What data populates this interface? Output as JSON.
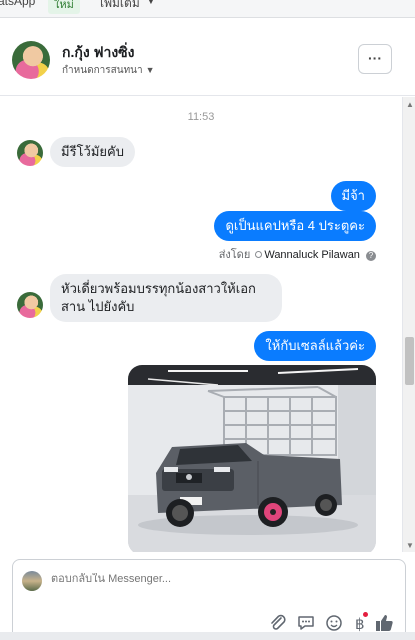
{
  "topbar": {
    "tab_label": "atsApp",
    "badge": "ใหม่",
    "more_label": "เพิ่มเติม"
  },
  "header": {
    "name": "ก.กุ้ง ฟางซิ่ง",
    "subtitle": "กำหนดการสนทนา",
    "more_button": "···"
  },
  "chat": {
    "timestamp": "11:53",
    "messages": [
      {
        "from": "customer",
        "text": "มีรีโว้มัยคับ"
      },
      {
        "from": "page",
        "text": "มีจ้า"
      },
      {
        "from": "page",
        "text": "ดูเป็นแคปหรือ 4 ประตูคะ"
      },
      {
        "from": "customer",
        "text": "หัวเดี่ยวพร้อมบรรทุกน้องสาวให้เอกสาน ไปยังคับ"
      },
      {
        "from": "page",
        "text": "ให้กับเซลล์แล้วค่ะ"
      }
    ],
    "sent_by_prefix": "ส่งโดย",
    "sent_by_name": "Wannaluck Pilawan"
  },
  "composer": {
    "placeholder": "ตอบกลับใน Messenger..."
  },
  "colors": {
    "outgoing": "#0a7cff",
    "incoming": "#ebedf0",
    "accent": "#1877f2"
  }
}
